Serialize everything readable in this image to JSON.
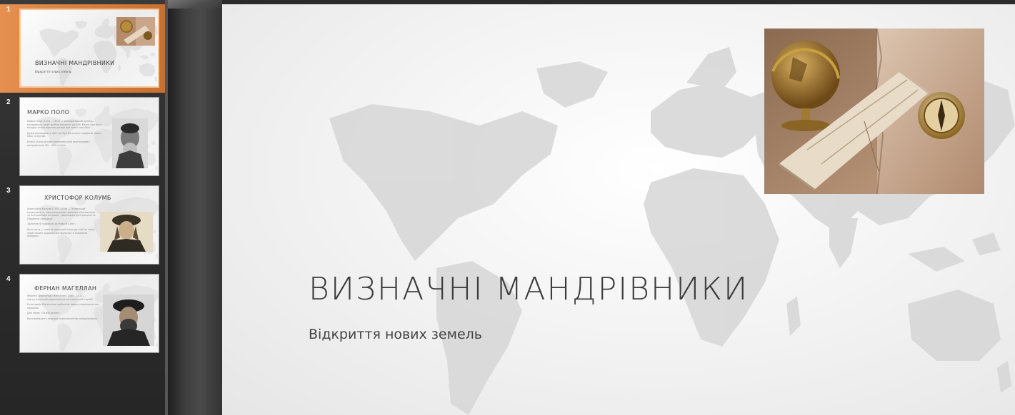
{
  "slides_panel": {
    "slides": [
      {
        "number": "1",
        "title": "ВИЗНАЧНІ МАНДРІВНИКИ",
        "subtitle": "Відкриття нових земель",
        "bullets": [],
        "image": "globe-and-map-photo",
        "selected": true
      },
      {
        "number": "2",
        "title": "МАРКО ПОЛО",
        "subtitle": "",
        "bullets": [
          "Марко Поло (1254 – 1324) — венеціанський купець і мандрівник, який зробив подорож до Азії. Книга про його мандри стала відомим джерелом знань про Азію.",
          "Дуже впливовим у свій час був його опис подорожі через Азію та Китай.",
          "Книга стала цінним джерелом для картографів і мандрівників XIV – XVI століть."
        ],
        "image": "marco-polo-portrait",
        "selected": false
      },
      {
        "number": "3",
        "title": "ХРИСТОФОР КОЛУМБ",
        "subtitle": "",
        "bullets": [
          "Христофор Колумб (1451-1506) — іспанський мореплавець, першовідкривач Америки (Багамських та Антильських островів, узбережжя Центральної та Південної Америки).",
          "Здійснив 4 подорожі до Нового Світу.",
          "Його мета — знайти морський шлях до Індії на захід через океан, вздовж Центральної та Південної Америки."
        ],
        "image": "columbus-portrait",
        "selected": false
      },
      {
        "number": "4",
        "title": "ФЕРНАН МАГЕЛЛАН",
        "subtitle": "",
        "bullets": [
          "Фернан (Фернандо) Магеллан (1480 – 1521) – португальський мореплавець на іспанській службі.",
          "Експедиція Магеллана здійснила першу навколосвітню подорож.",
          "Дав назву «Тихий океан».",
          "Його вважають першим навколосвітнім мандрівником."
        ],
        "image": "magellan-portrait",
        "selected": false
      }
    ]
  },
  "current_slide": {
    "title": "ВИЗНАЧНІ МАНДРІВНИКИ",
    "subtitle": "Відкриття нових земель",
    "image": "globe-compass-scroll-photo",
    "background": "world-map"
  },
  "colors": {
    "selection_accent": "#e08a44",
    "panel_background": "#2e2e2e",
    "title_text": "#3c3c3c",
    "map_fill": "#d2d2d2"
  }
}
